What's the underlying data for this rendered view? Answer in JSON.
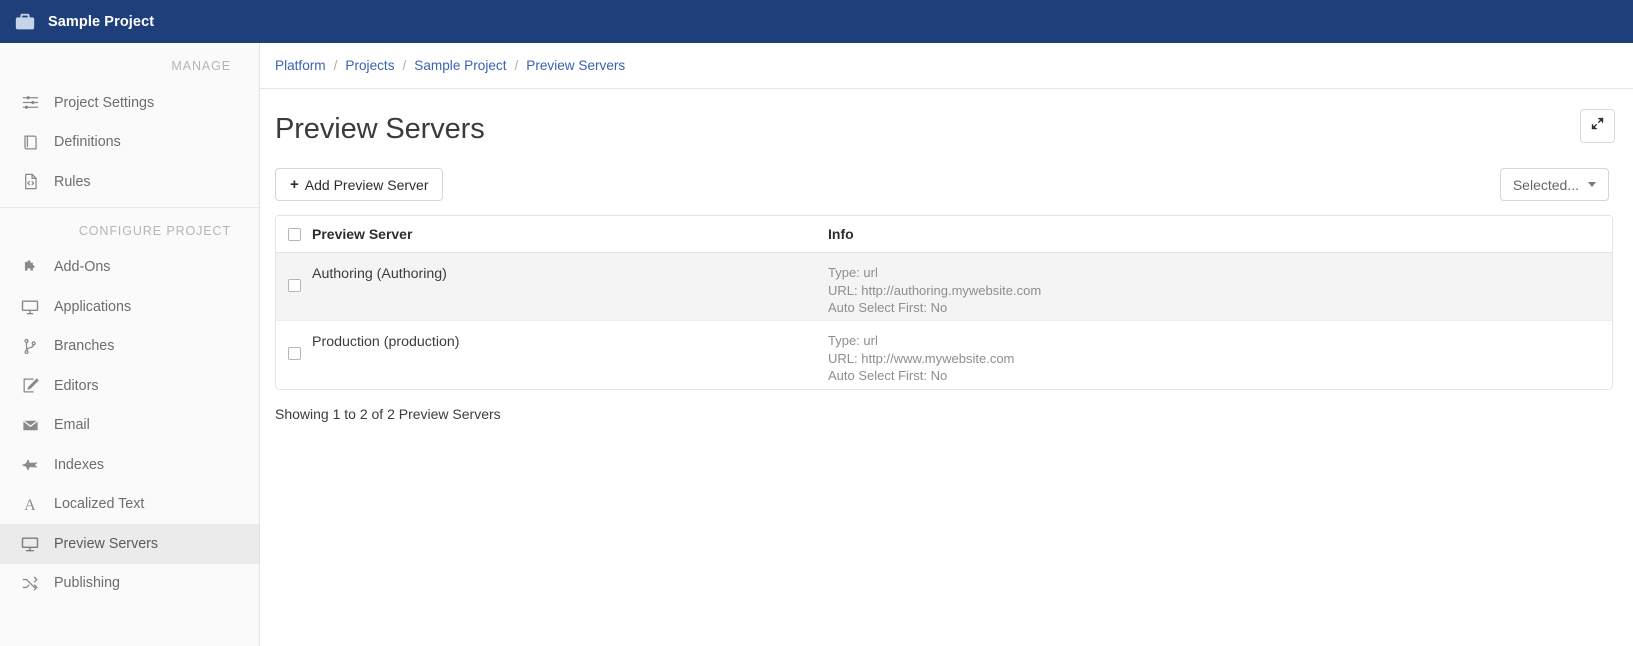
{
  "topbar": {
    "icon": "briefcase-icon",
    "title": "Sample Project"
  },
  "sidebar": {
    "sections": [
      {
        "label": "MANAGE",
        "items": [
          {
            "label": "Project Settings",
            "icon": "sliders-icon",
            "active": false
          },
          {
            "label": "Definitions",
            "icon": "book-icon",
            "active": false
          },
          {
            "label": "Rules",
            "icon": "code-file-icon",
            "active": false
          }
        ]
      },
      {
        "label": "CONFIGURE PROJECT",
        "items": [
          {
            "label": "Add-Ons",
            "icon": "puzzle-piece-icon",
            "active": false
          },
          {
            "label": "Applications",
            "icon": "monitor-icon",
            "active": false
          },
          {
            "label": "Branches",
            "icon": "code-branch-icon",
            "active": false
          },
          {
            "label": "Editors",
            "icon": "pencil-square-icon",
            "active": false
          },
          {
            "label": "Email",
            "icon": "envelope-icon",
            "active": false
          },
          {
            "label": "Indexes",
            "icon": "plane-icon",
            "active": false
          },
          {
            "label": "Localized Text",
            "icon": "font-letter-icon",
            "active": false
          },
          {
            "label": "Preview Servers",
            "icon": "display-icon",
            "active": true
          },
          {
            "label": "Publishing",
            "icon": "shuffle-icon",
            "active": false
          }
        ]
      }
    ]
  },
  "breadcrumb": {
    "items": [
      "Platform",
      "Projects",
      "Sample Project",
      "Preview Servers"
    ],
    "separator": "/"
  },
  "page": {
    "title": "Preview Servers",
    "collapse_icon": "compress-arrows-icon"
  },
  "toolbar": {
    "add_label": "Add Preview Server",
    "add_icon": "plus-icon",
    "selected_label": "Selected...",
    "selected_caret_icon": "caret-down-icon"
  },
  "table": {
    "columns": [
      "Preview Server",
      "Info"
    ],
    "select_all_checkbox": false,
    "rows": [
      {
        "checked": false,
        "name": "Authoring (Authoring)",
        "info": [
          "Type: url",
          "URL: http://authoring.mywebsite.com",
          "Auto Select First: No"
        ]
      },
      {
        "checked": false,
        "name": "Production (production)",
        "info": [
          "Type: url",
          "URL: http://www.mywebsite.com",
          "Auto Select First: No"
        ]
      }
    ]
  },
  "footer": {
    "showing": "Showing 1 to 2 of 2 Preview Servers"
  },
  "colors": {
    "topbar_bg": "#1f3f7a",
    "sidebar_bg": "#fafafa",
    "active_item_bg": "#ebebeb",
    "link": "#3a62b1",
    "row_alt_bg": "#f4f4f4"
  }
}
